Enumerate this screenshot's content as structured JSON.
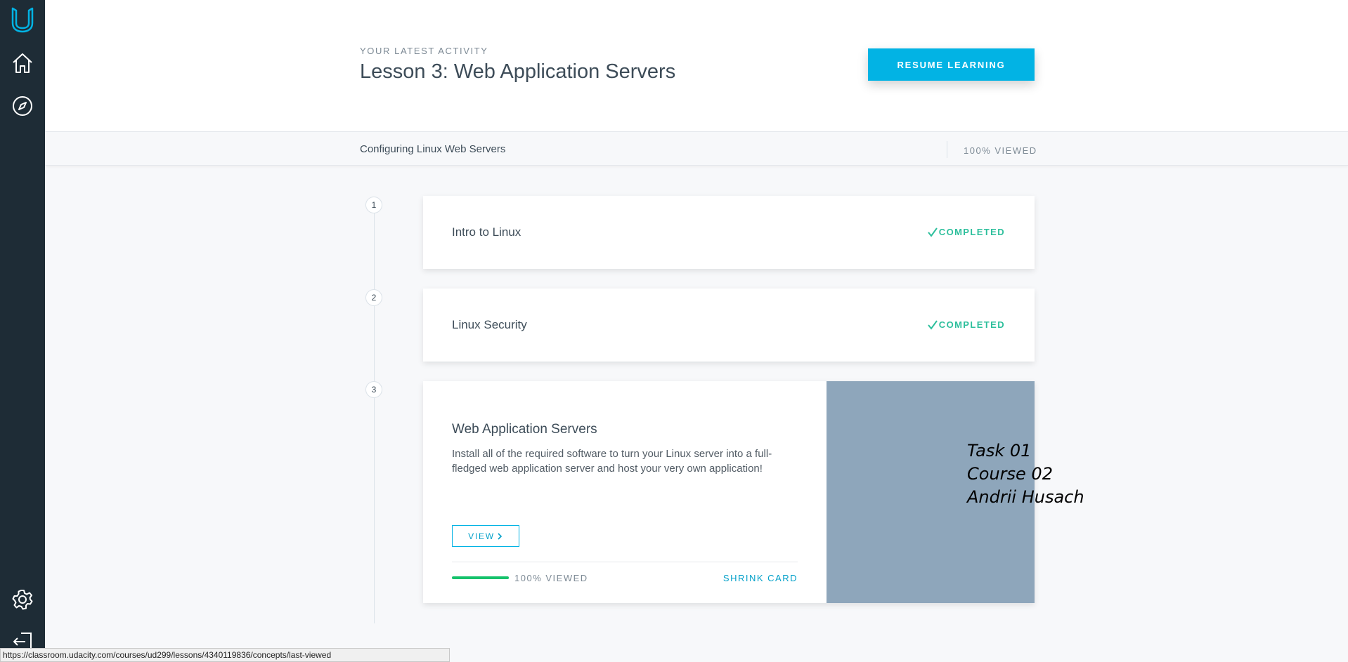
{
  "sidebar": {
    "icons": [
      "udacity-logo-icon",
      "home-icon",
      "compass-icon",
      "gear-icon",
      "logout-icon"
    ]
  },
  "header": {
    "eyebrow": "YOUR LATEST ACTIVITY",
    "lesson_title": "Lesson 3: Web Application Servers",
    "resume_label": "RESUME LEARNING"
  },
  "subbar": {
    "course_name": "Configuring Linux Web Servers",
    "viewed": "100% VIEWED"
  },
  "lessons": [
    {
      "number": "1",
      "title": "Intro to Linux",
      "status": "COMPLETED"
    },
    {
      "number": "2",
      "title": "Linux Security",
      "status": "COMPLETED"
    },
    {
      "number": "3",
      "title": "Web Application Servers",
      "description": "Install all of the required software to turn your Linux server into a full-fledged web application server and host your very own application!",
      "view_label": "VIEW",
      "progress": 1.0,
      "viewed": "100% VIEWED",
      "shrink_label": "SHRINK CARD"
    }
  ],
  "overlay_text": {
    "line1": "Task 01",
    "line2": "Course 02",
    "line3": "Andrii Husach"
  },
  "statusbar": {
    "url": "https://classroom.udacity.com/courses/ud299/lessons/4340119836/concepts/last-viewed"
  },
  "colors": {
    "sidebar": "#1e2c36",
    "accent": "#02b3e4",
    "success": "#2dbf9c",
    "progress": "#15c26b",
    "card_image": "#8ea6bb"
  }
}
